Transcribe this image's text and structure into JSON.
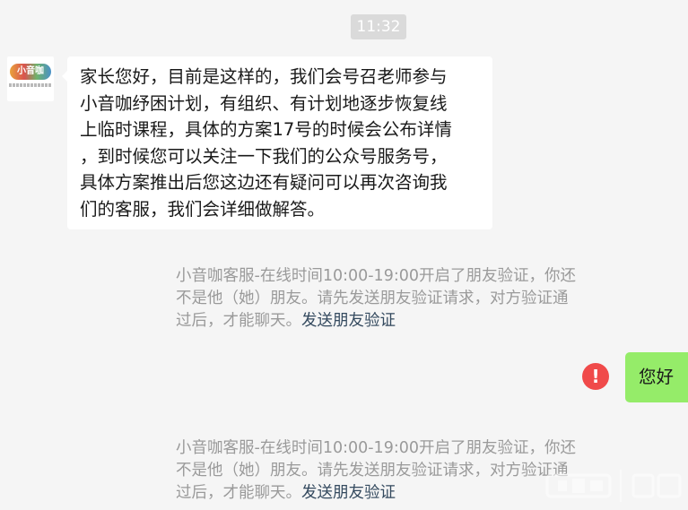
{
  "chat": {
    "timestamp": "11:32",
    "incoming": {
      "sender_avatar_icon": "xiaoyinka-logo-icon",
      "lines": [
        "家长您好，目前是这样的，我们会号召老师参与",
        "小音咖纾困计划，有组织、有计划地逐步恢复线",
        "上临时课程，具体的方案17号的时候会公布详情",
        "，到时候您可以关注一下我们的公众号服务号，",
        "具体方案推出后您这边还有疑问可以再次咨询我",
        "们的客服，我们会详细做解答。"
      ]
    },
    "system_notices": [
      {
        "lines": [
          "小音咖客服-在线时间10:00-19:00开启了朋友验证，你还",
          "不是他（她）朋友。请先发送朋友验证请求，对方验证通",
          "过后，才能聊天。"
        ],
        "link": "发送朋友验证"
      },
      {
        "lines": [
          "小音咖客服-在线时间10:00-19:00开启了朋友验证，你还",
          "不是他（她）朋友。请先发送朋友验证请求，对方验证通",
          "过后，才能聊天。"
        ],
        "link": "发送朋友验证"
      }
    ],
    "outgoing": {
      "text": "您好",
      "status_icon": "send-failed-icon"
    }
  },
  "colors": {
    "background": "#f5f5f5",
    "incoming_bubble": "#ffffff",
    "outgoing_bubble": "#95ec69",
    "error": "#f04a4a",
    "system_text": "#9a9a9a",
    "link_text": "#33495e"
  }
}
